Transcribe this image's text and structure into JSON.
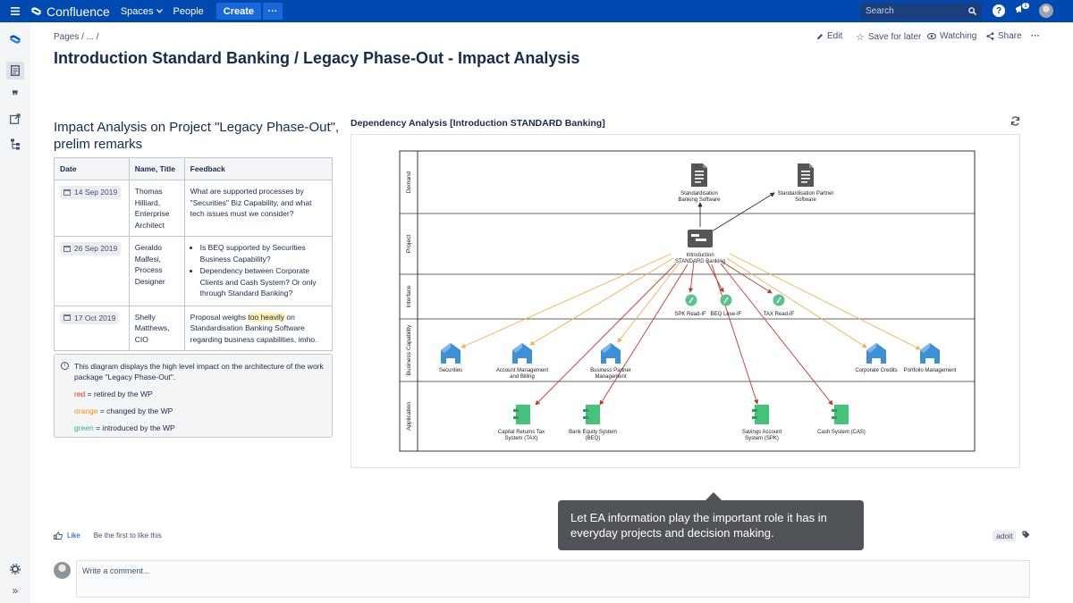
{
  "topnav": {
    "app_name": "Confluence",
    "spaces": "Spaces",
    "people": "People",
    "create": "Create",
    "more": "···",
    "search_placeholder": "Search",
    "notification_count": "1"
  },
  "breadcrumb": "Pages  /  ...  /",
  "actions": {
    "edit": "Edit",
    "save": "Save for later",
    "watch": "Watching",
    "share": "Share",
    "more": "···"
  },
  "page_title": "Introduction Standard Banking / Legacy Phase-Out - Impact Analysis",
  "impact": {
    "title": "Impact Analysis on Project \"Legacy Phase-Out\", prelim remarks",
    "headers": [
      "Date",
      "Name, Title",
      "Feedback"
    ],
    "rows": [
      {
        "date": "14 Sep 2019",
        "name": "Thomas Hilliard, Enterprise Architect",
        "feedback": "What are supported processes by \"Securities\" Biz Capability, and what tech issues must we consider?"
      },
      {
        "date": "26 Sep 2019",
        "name": "Geraldo Malfesi, Process Designer",
        "bullets": [
          "Is BEQ supported by Securities Business Capability?",
          "Dependency between Corporate Clients and Cash System? Or only through Standard Banking?"
        ]
      },
      {
        "date": "17 Oct 2019",
        "name": "Shelly Matthews, CIO",
        "feedback_pre": "Proposal weighs ",
        "feedback_hl": "too heavily",
        "feedback_post": " on Standardisation Banking Software regarding business capabilities, imho."
      }
    ]
  },
  "info": {
    "intro": "This diagram displays the high level impact on the architecture of the work package \"Legacy Phase-Out\".",
    "legend": [
      {
        "word": "red",
        "text": " = retired by the WP",
        "color": "#de350b"
      },
      {
        "word": "orange",
        "text": " = changed by the WP",
        "color": "#ff8b00"
      },
      {
        "word": "green",
        "text": " = introduced by the WP",
        "color": "#36b37e"
      }
    ]
  },
  "diagram": {
    "title": "Dependency Analysis [Introduction STANDARD Banking]",
    "lanes": [
      "Demand",
      "Project",
      "Interface",
      "Business Capability",
      "Application"
    ],
    "demand": [
      {
        "l1": "Standardisation",
        "l2": "Banking Software"
      },
      {
        "l1": "Standardisation Partner",
        "l2": "Software"
      }
    ],
    "project": {
      "l1": "Introduction",
      "l2": "STANDARD Banking"
    },
    "interfaces": [
      "SPK Read-IF",
      "BEQ Lese-IF",
      "TAX Read-IF"
    ],
    "capabilities": [
      {
        "l1": "Securities",
        "l2": ""
      },
      {
        "l1": "Account Management",
        "l2": "and Billing"
      },
      {
        "l1": "Business Partner",
        "l2": "Management"
      },
      {
        "l1": "Corporate Credits",
        "l2": ""
      },
      {
        "l1": "Portfolio Management",
        "l2": ""
      }
    ],
    "applications": [
      {
        "l1": "Capital Returns Tax",
        "l2": "System (TAX)"
      },
      {
        "l1": "Bank Equity System",
        "l2": "(BEQ)"
      },
      {
        "l1": "Savings Account",
        "l2": "System (SPK)"
      },
      {
        "l1": "Cash System (CAS)",
        "l2": ""
      }
    ],
    "interface_marker": "",
    "colors": {
      "retired": "#c0392b",
      "changed": "#f2b150",
      "introduced": "#36b37e",
      "capability": "#3d8fd6",
      "application": "#47c27a"
    }
  },
  "tooltip": "Let EA information play the important role it has in everyday projects and decision making.",
  "footer": {
    "like": "Like",
    "like_hint": "Be the first to like this",
    "label": "adoit",
    "comment_placeholder": "Write a comment..."
  }
}
